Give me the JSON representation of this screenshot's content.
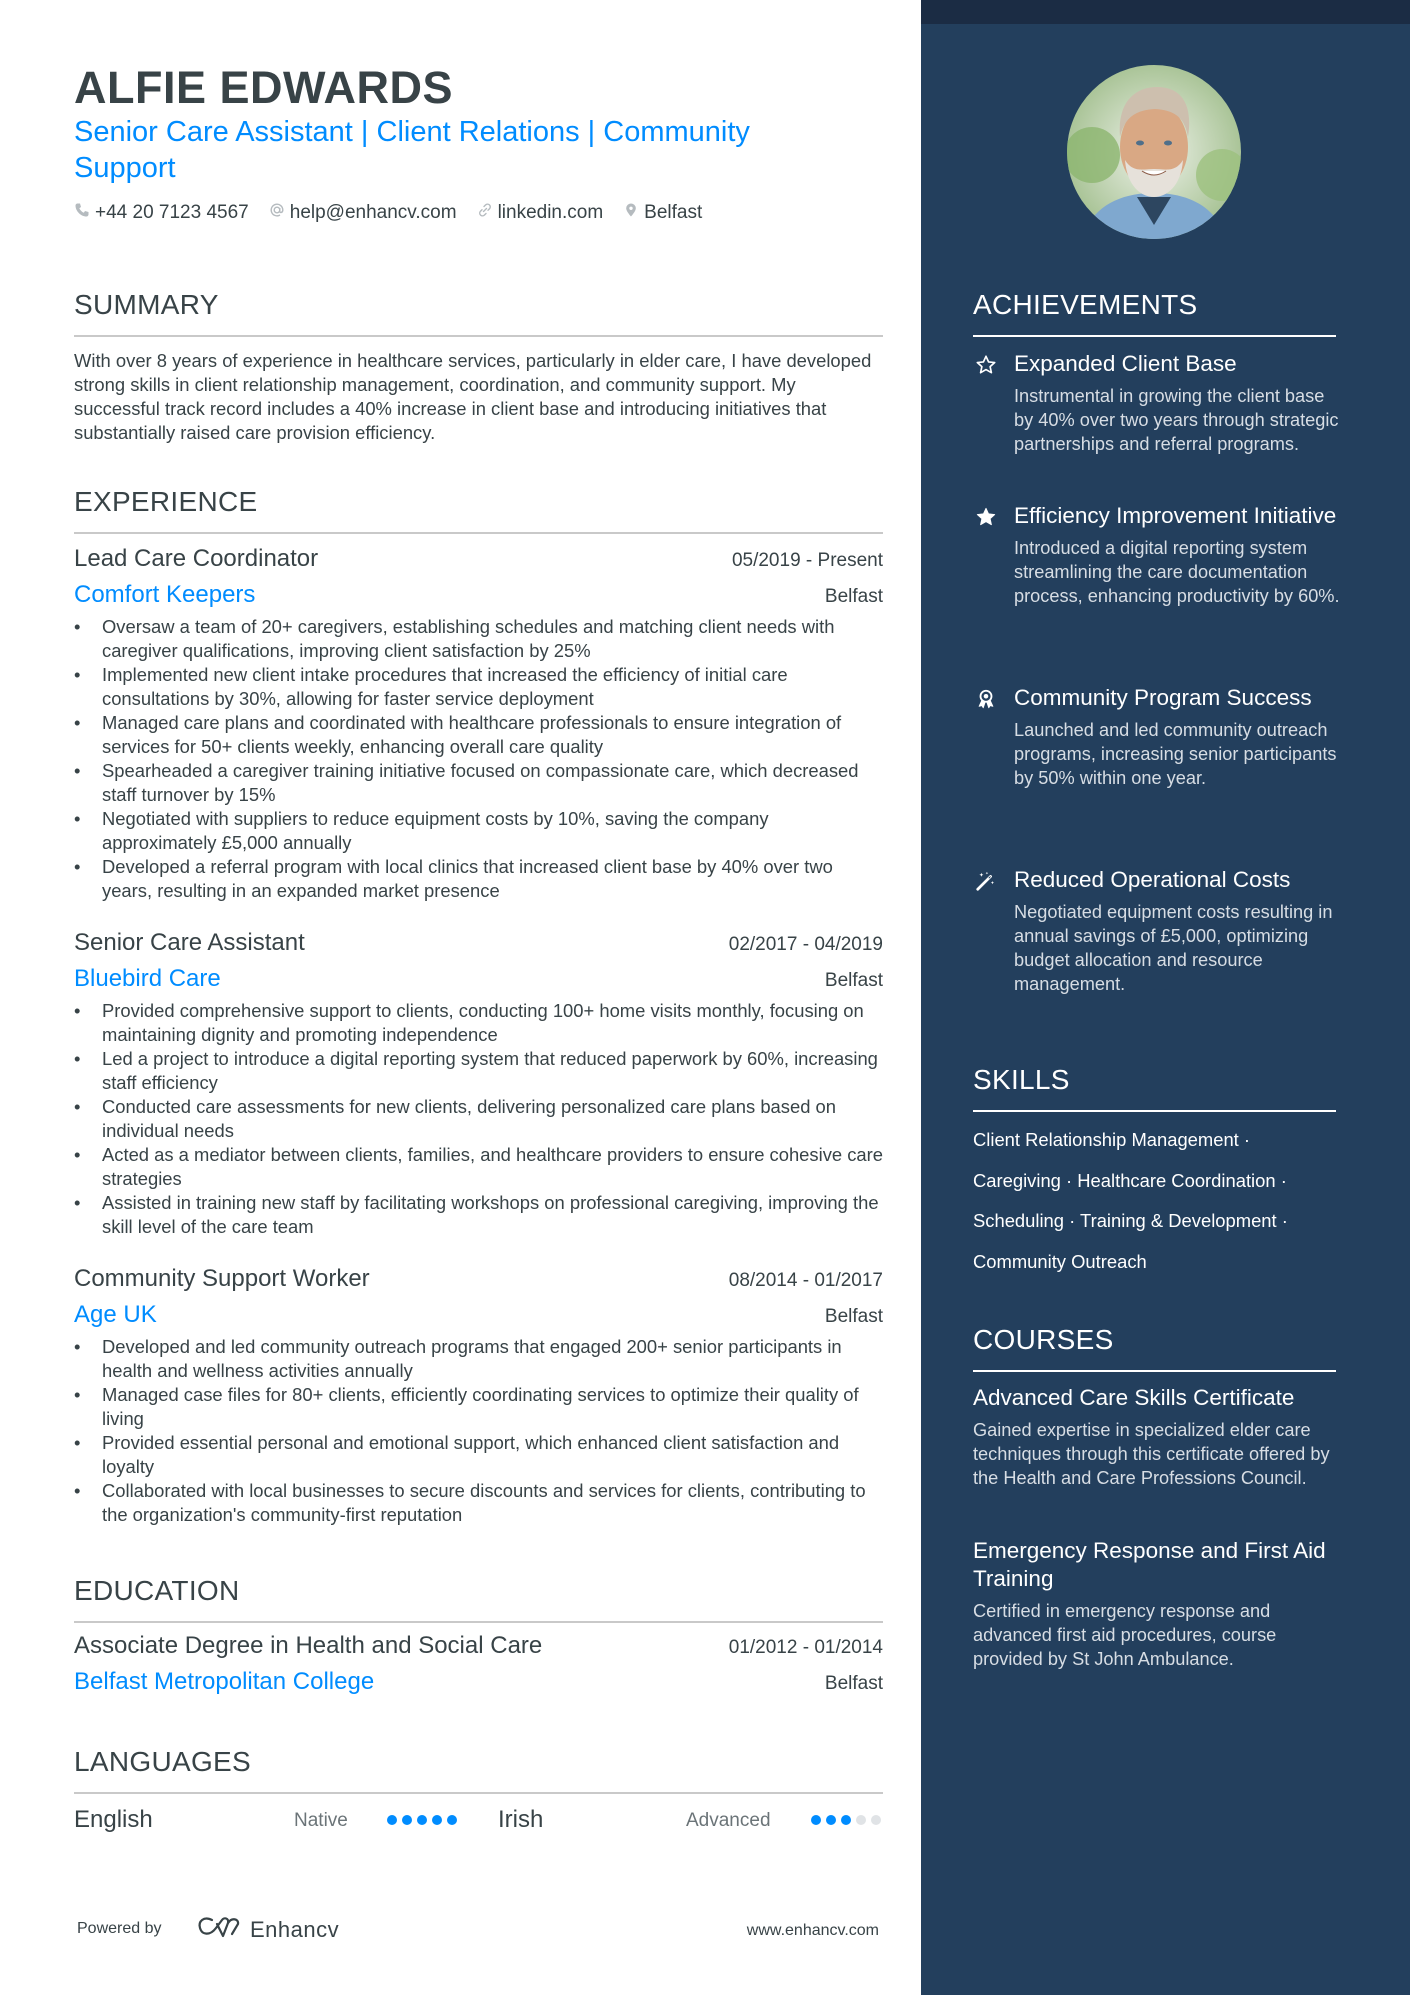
{
  "header": {
    "name": "ALFIE EDWARDS",
    "headline": "Senior Care Assistant | Client Relations | Community Support",
    "contacts": [
      {
        "icon": "phone-icon",
        "text": "+44 20 7123 4567"
      },
      {
        "icon": "at-icon",
        "text": "help@enhancv.com"
      },
      {
        "icon": "link-icon",
        "text": "linkedin.com"
      },
      {
        "icon": "location-pin-icon",
        "text": "Belfast"
      }
    ]
  },
  "summary": {
    "title": "SUMMARY",
    "text": "With over 8 years of experience in healthcare services, particularly in elder care, I have developed strong skills in client relationship management, coordination, and community support. My successful track record includes a 40% increase in client base and introducing initiatives that substantially raised care provision efficiency."
  },
  "experience": {
    "title": "EXPERIENCE",
    "jobs": [
      {
        "title": "Lead Care Coordinator",
        "dates": "05/2019 - Present",
        "company": "Comfort Keepers",
        "location": "Belfast",
        "bullets": [
          "Oversaw a team of 20+ caregivers, establishing schedules and matching client needs with caregiver qualifications, improving client satisfaction by 25%",
          "Implemented new client intake procedures that increased the efficiency of initial care consultations by 30%, allowing for faster service deployment",
          "Managed care plans and coordinated with healthcare professionals to ensure integration of services for 50+ clients weekly, enhancing overall care quality",
          "Spearheaded a caregiver training initiative focused on compassionate care, which decreased staff turnover by 15%",
          "Negotiated with suppliers to reduce equipment costs by 10%, saving the company approximately £5,000 annually",
          "Developed a referral program with local clinics that increased client base by 40% over two years, resulting in an expanded market presence"
        ]
      },
      {
        "title": "Senior Care Assistant",
        "dates": "02/2017 - 04/2019",
        "company": "Bluebird Care",
        "location": "Belfast",
        "bullets": [
          "Provided comprehensive support to clients, conducting 100+ home visits monthly, focusing on maintaining dignity and promoting independence",
          "Led a project to introduce a digital reporting system that reduced paperwork by 60%, increasing staff efficiency",
          "Conducted care assessments for new clients, delivering personalized care plans based on individual needs",
          "Acted as a mediator between clients, families, and healthcare providers to ensure cohesive care strategies",
          "Assisted in training new staff by facilitating workshops on professional caregiving, improving the skill level of the care team"
        ]
      },
      {
        "title": "Community Support Worker",
        "dates": "08/2014 - 01/2017",
        "company": "Age UK",
        "location": "Belfast",
        "bullets": [
          "Developed and led community outreach programs that engaged 200+ senior participants in health and wellness activities annually",
          "Managed case files for 80+ clients, efficiently coordinating services to optimize their quality of living",
          "Provided essential personal and emotional support, which enhanced client satisfaction and loyalty",
          "Collaborated with local businesses to secure discounts and services for clients, contributing to the organization's community-first reputation"
        ]
      }
    ]
  },
  "education": {
    "title": "EDUCATION",
    "items": [
      {
        "degree": "Associate Degree in Health and Social Care",
        "dates": "01/2012 - 01/2014",
        "school": "Belfast Metropolitan College",
        "location": "Belfast"
      }
    ]
  },
  "languages": {
    "title": "LANGUAGES",
    "items": [
      {
        "name": "English",
        "level": "Native",
        "rating": 5,
        "max": 5
      },
      {
        "name": "Irish",
        "level": "Advanced",
        "rating": 3,
        "max": 5
      }
    ]
  },
  "footer": {
    "powered_by": "Powered by",
    "brand": "Enhancv",
    "url": "www.enhancv.com"
  },
  "sidebar": {
    "achievements": {
      "title": "ACHIEVEMENTS",
      "items": [
        {
          "icon": "star-outline-icon",
          "title": "Expanded Client Base",
          "description": "Instrumental in growing the client base by 40% over two years through strategic partnerships and referral programs."
        },
        {
          "icon": "star-filled-icon",
          "title": "Efficiency Improvement Initiative",
          "description": "Introduced a digital reporting system streamlining the care documentation process, enhancing productivity by 60%."
        },
        {
          "icon": "award-ribbon-icon",
          "title": "Community Program Success",
          "description": "Launched and led community outreach programs, increasing senior participants by 50% within one year."
        },
        {
          "icon": "magic-wand-icon",
          "title": "Reduced Operational Costs",
          "description": "Negotiated equipment costs resulting in annual savings of £5,000, optimizing budget allocation and resource management."
        }
      ]
    },
    "skills": {
      "title": "SKILLS",
      "items": [
        "Client Relationship Management",
        "Caregiving",
        "Healthcare Coordination",
        "Scheduling",
        "Training & Development",
        "Community Outreach"
      ]
    },
    "courses": {
      "title": "COURSES",
      "items": [
        {
          "title": "Advanced Care Skills Certificate",
          "description": "Gained expertise in specialized elder care techniques through this certificate offered by the Health and Care Professions Council."
        },
        {
          "title": "Emergency Response and First Aid Training",
          "description": "Certified in emergency response and advanced first aid procedures, course provided by St John Ambulance."
        }
      ]
    }
  },
  "colors": {
    "accent": "#008cff",
    "text": "#384347",
    "sidebar_bg": "#233f5d",
    "sidebar_strip": "#1b2c44",
    "dot_off": "#e0e3e6"
  }
}
